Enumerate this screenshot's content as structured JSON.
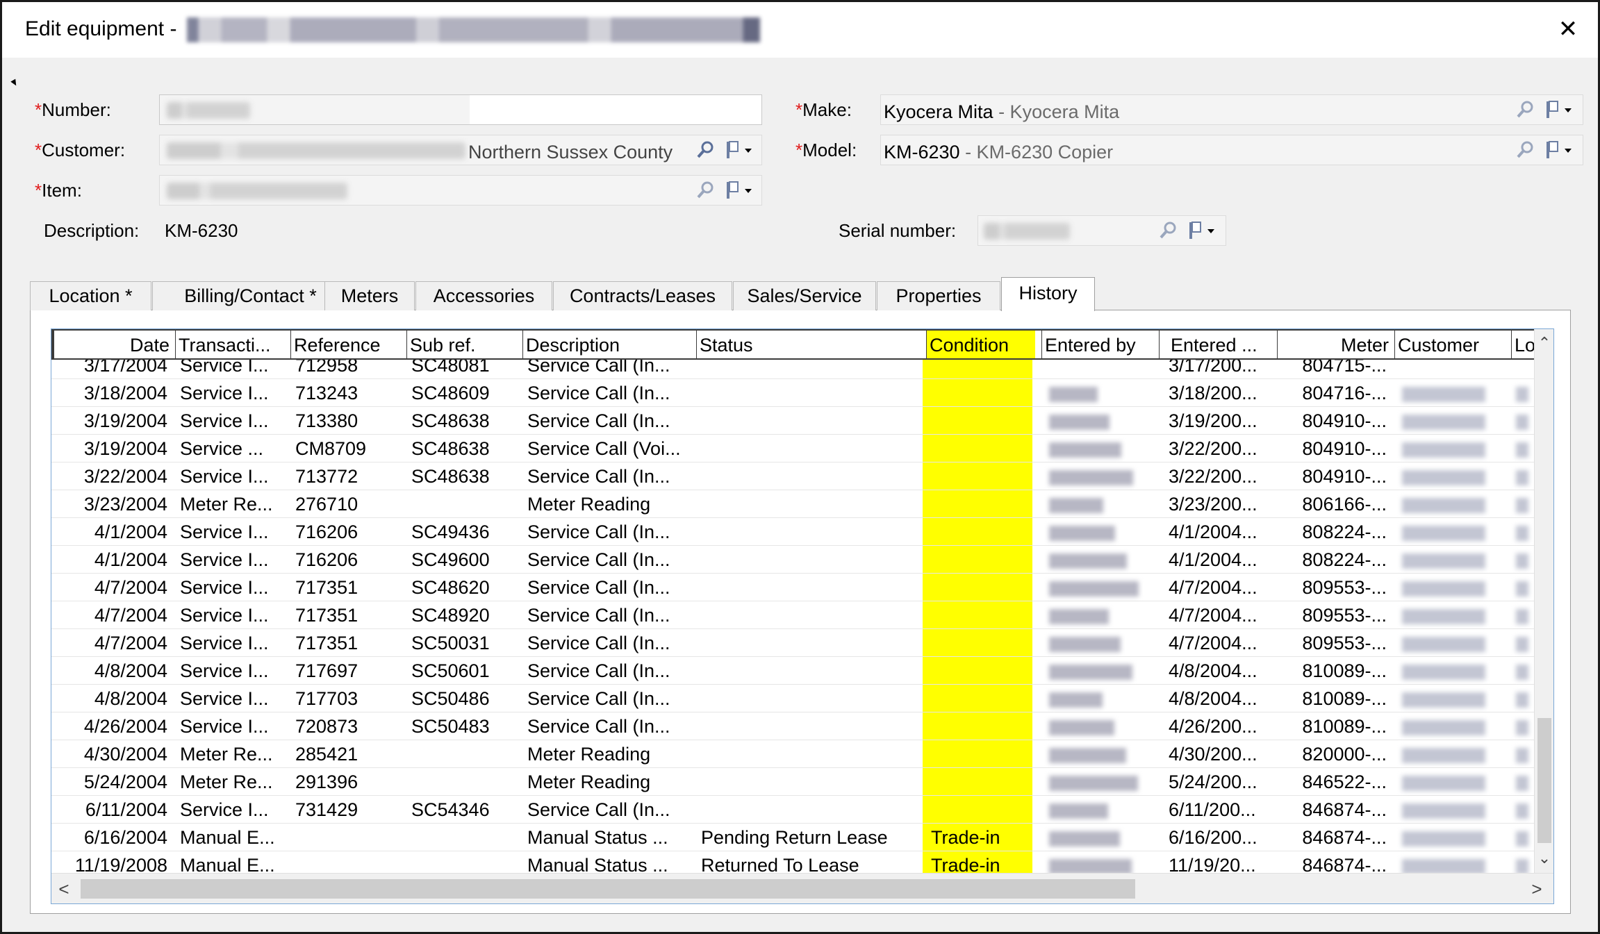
{
  "window": {
    "title_prefix": "Edit equipment - ",
    "close_glyph": "✕"
  },
  "form": {
    "number_label": "Number:",
    "customer_label": "Customer:",
    "customer_visible_text": "Northern Sussex County",
    "item_label": "Item:",
    "description_label": "Description:",
    "description_value": "KM-6230",
    "make_label": "Make:",
    "make_value": "Kyocera Mita",
    "make_sub": " - Kyocera Mita",
    "model_label": "Model:",
    "model_value": "KM-6230",
    "model_sub": " - KM-6230 Copier",
    "serial_label": "Serial number:",
    "required_mark": "*"
  },
  "tabs": [
    {
      "label": "Location *",
      "active": false
    },
    {
      "label": "Billing/Contact *",
      "active": false
    },
    {
      "label": "Meters",
      "active": false
    },
    {
      "label": "Accessories",
      "active": false
    },
    {
      "label": "Contracts/Leases",
      "active": false
    },
    {
      "label": "Sales/Service",
      "active": false
    },
    {
      "label": "Properties",
      "active": false
    },
    {
      "label": "History",
      "active": true
    }
  ],
  "grid": {
    "columns": [
      "Date",
      "Transacti...",
      "Reference",
      "Sub ref.",
      "Description",
      "Status",
      "Condition",
      "Entered by",
      "Entered ...",
      "Meter",
      "Customer",
      "Loc"
    ],
    "highlight_color": "#ffff00",
    "partial_row": [
      "3/17/2004",
      "Service I...",
      "712958",
      "SC48081",
      "Service Call (In...",
      "",
      "",
      "",
      "3/17/200...",
      "804715-...",
      "",
      ""
    ],
    "rows": [
      [
        "3/18/2004",
        "Service I...",
        "713243",
        "SC48609",
        "Service Call (In...",
        "",
        ""
      ],
      [
        "3/19/2004",
        "Service I...",
        "713380",
        "SC48638",
        "Service Call (In...",
        "",
        ""
      ],
      [
        "3/19/2004",
        "Service ...",
        "CM8709",
        "SC48638",
        "Service Call (Voi...",
        "",
        ""
      ],
      [
        "3/22/2004",
        "Service I...",
        "713772",
        "SC48638",
        "Service Call (In...",
        "",
        ""
      ],
      [
        "3/23/2004",
        "Meter Re...",
        "276710",
        "",
        "Meter Reading",
        "",
        ""
      ],
      [
        "4/1/2004",
        "Service I...",
        "716206",
        "SC49436",
        "Service Call (In...",
        "",
        ""
      ],
      [
        "4/1/2004",
        "Service I...",
        "716206",
        "SC49600",
        "Service Call (In...",
        "",
        ""
      ],
      [
        "4/7/2004",
        "Service I...",
        "717351",
        "SC48620",
        "Service Call (In...",
        "",
        ""
      ],
      [
        "4/7/2004",
        "Service I...",
        "717351",
        "SC48920",
        "Service Call (In...",
        "",
        ""
      ],
      [
        "4/7/2004",
        "Service I...",
        "717351",
        "SC50031",
        "Service Call (In...",
        "",
        ""
      ],
      [
        "4/8/2004",
        "Service I...",
        "717697",
        "SC50601",
        "Service Call (In...",
        "",
        ""
      ],
      [
        "4/8/2004",
        "Service I...",
        "717703",
        "SC50486",
        "Service Call (In...",
        "",
        ""
      ],
      [
        "4/26/2004",
        "Service I...",
        "720873",
        "SC50483",
        "Service Call (In...",
        "",
        ""
      ],
      [
        "4/30/2004",
        "Meter Re...",
        "285421",
        "",
        "Meter Reading",
        "",
        ""
      ],
      [
        "5/24/2004",
        "Meter Re...",
        "291396",
        "",
        "Meter Reading",
        "",
        ""
      ],
      [
        "6/11/2004",
        "Service I...",
        "731429",
        "SC54346",
        "Service Call (In...",
        "",
        ""
      ],
      [
        "6/16/2004",
        "Manual E...",
        "",
        "",
        "Manual Status ...",
        "Pending Return Lease",
        "Trade-in"
      ],
      [
        "11/19/2008",
        "Manual E...",
        "",
        "",
        "Manual Status ...",
        "Returned To Lease",
        "Trade-in"
      ]
    ],
    "entered_dates": [
      "3/18/200...",
      "3/19/200...",
      "3/22/200...",
      "3/22/200...",
      "3/23/200...",
      "4/1/2004...",
      "4/1/2004...",
      "4/7/2004...",
      "4/7/2004...",
      "4/7/2004...",
      "4/8/2004...",
      "4/8/2004...",
      "4/26/200...",
      "4/30/200...",
      "5/24/200...",
      "6/11/200...",
      "6/16/200...",
      "11/19/20..."
    ],
    "meters": [
      "804716-...",
      "804910-...",
      "804910-...",
      "804910-...",
      "806166-...",
      "808224-...",
      "808224-...",
      "809553-...",
      "809553-...",
      "809553-...",
      "810089-...",
      "810089-...",
      "810089-...",
      "820000-...",
      "846522-...",
      "846874-...",
      "846874-...",
      "846874-..."
    ]
  },
  "scroll": {
    "up": "⌃",
    "down": "⌄",
    "left": "<",
    "right": ">"
  }
}
